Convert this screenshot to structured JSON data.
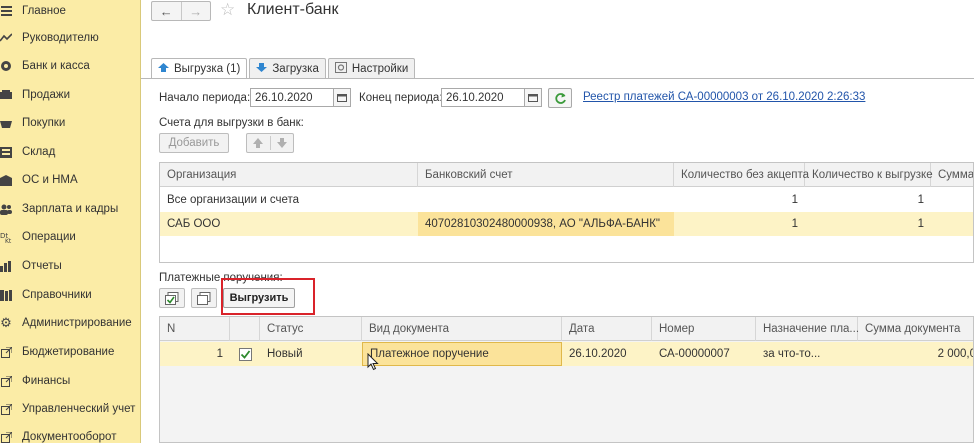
{
  "sidebar": {
    "items": [
      {
        "label": "Главное",
        "icon": "menu-icon"
      },
      {
        "label": "Руководителю",
        "icon": "trend-icon"
      },
      {
        "label": "Банк и касса",
        "icon": "coins-icon"
      },
      {
        "label": "Продажи",
        "icon": "cart-icon"
      },
      {
        "label": "Покупки",
        "icon": "basket-icon"
      },
      {
        "label": "Склад",
        "icon": "warehouse-icon"
      },
      {
        "label": "ОС и НМА",
        "icon": "building-icon"
      },
      {
        "label": "Зарплата и кадры",
        "icon": "people-icon"
      },
      {
        "label": "Операции",
        "icon": "operations-icon"
      },
      {
        "label": "Отчеты",
        "icon": "chart-icon"
      },
      {
        "label": "Справочники",
        "icon": "books-icon"
      },
      {
        "label": "Администрирование",
        "icon": "gear-icon"
      },
      {
        "label": "Бюджетирование",
        "icon": "external-icon"
      },
      {
        "label": "Финансы",
        "icon": "external-icon"
      },
      {
        "label": "Управленческий учет",
        "icon": "external-icon"
      },
      {
        "label": "Документооборот",
        "icon": "external-icon"
      }
    ]
  },
  "header": {
    "back": "←",
    "forward": "→",
    "star": "☆",
    "title": "Клиент-банк"
  },
  "tabs": [
    {
      "label": "Выгрузка (1)",
      "icon": "upload-icon",
      "active": true
    },
    {
      "label": "Загрузка",
      "icon": "download-icon",
      "active": false
    },
    {
      "label": "Настройки",
      "icon": "settings-icon",
      "active": false
    }
  ],
  "period": {
    "start_label": "Начало периода:",
    "start_value": "26.10.2020",
    "end_label": "Конец периода:",
    "end_value": "26.10.2020",
    "registry_link": "Реестр платежей СА-00000003 от 26.10.2020 2:26:33"
  },
  "accounts": {
    "label": "Счета для выгрузки в банк:",
    "add_button": "Добавить",
    "up": "🡅",
    "down": "🡇",
    "columns": [
      "Организация",
      "Банковский счет",
      "Количество без акцепта",
      "Количество к выгрузке",
      "Сумма"
    ],
    "rows": [
      {
        "org": "Все организации и счета",
        "account": "",
        "no_accept": "1",
        "to_export": "1",
        "sum": ""
      },
      {
        "org": "САБ ООО",
        "account": "40702810302480000938, АО \"АЛЬФА-БАНК\"",
        "no_accept": "1",
        "to_export": "1",
        "sum": ""
      }
    ]
  },
  "payments": {
    "label": "Платежные поручения:",
    "export_button": "Выгрузить",
    "columns": [
      "N",
      "Статус",
      "Вид документа",
      "Дата",
      "Номер",
      "Назначение пла...",
      "Сумма документа"
    ],
    "rows": [
      {
        "n": "1",
        "status": "Новый",
        "doc_type": "Платежное поручение",
        "date": "26.10.2020",
        "number": "СА-00000007",
        "purpose": "за что-то...",
        "amount": "2 000,0"
      }
    ]
  },
  "colors": {
    "sidebar_bg": "#fbeca6",
    "row_highlight": "#fdf3c6",
    "cell_highlight": "#fbe39a",
    "link": "#2255aa",
    "annotation_box": "#d9232a"
  }
}
